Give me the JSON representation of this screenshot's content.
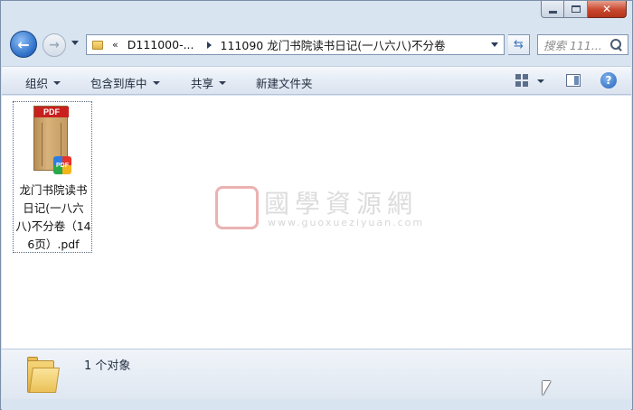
{
  "address_bar": {
    "overflow_chevron": "«",
    "segments": [
      "D111000-...",
      "111090 龙门书院读书日记(一八六八)不分卷"
    ]
  },
  "search": {
    "placeholder": "搜索 111..."
  },
  "toolbar": {
    "organize": "组织",
    "include_in_library": "包含到库中",
    "share": "共享",
    "new_folder": "新建文件夹"
  },
  "files": [
    {
      "name": "龙门书院读书日记(一八六八)不分卷（146页）.pdf",
      "icon": "pdf-file-icon",
      "badge": "PDF"
    }
  ],
  "watermark": {
    "title": "國學資源網",
    "url": "www.guoxueziyuan.com",
    "seal": "國"
  },
  "details": {
    "count_text": "1 个对象"
  },
  "colors": {
    "accent": "#2f72c8",
    "close": "#c8472d"
  }
}
